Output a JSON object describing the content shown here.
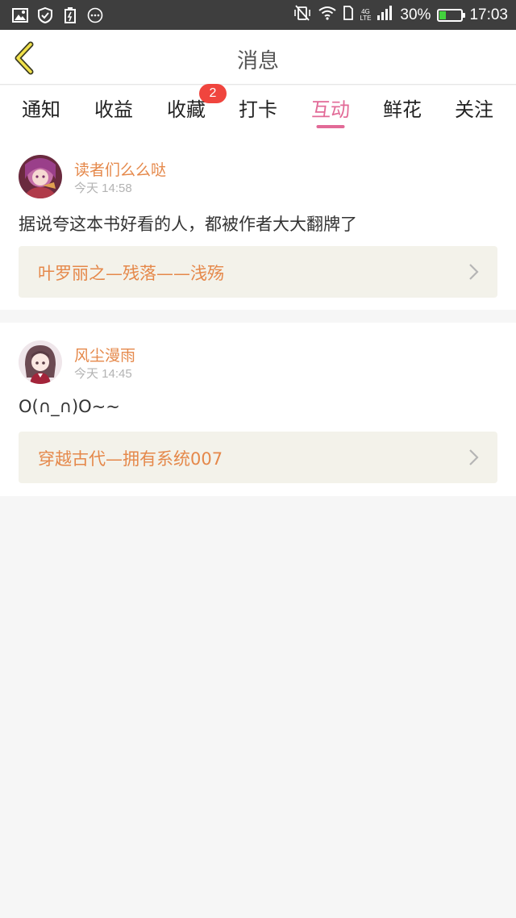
{
  "status_bar": {
    "left_icons": [
      "image-icon",
      "shield-icon",
      "battery-saver-icon",
      "more-dots-icon"
    ],
    "network": "4G",
    "network_sub": "LTE",
    "battery": "30%",
    "battery_level": 0.3,
    "time": "17:03"
  },
  "header": {
    "title": "消息"
  },
  "tabs": [
    {
      "label": "通知"
    },
    {
      "label": "收益"
    },
    {
      "label": "收藏",
      "badge": "2"
    },
    {
      "label": "打卡"
    },
    {
      "label": "互动",
      "active": true
    },
    {
      "label": "鲜花"
    },
    {
      "label": "关注"
    }
  ],
  "messages": [
    {
      "user": "读者们么么哒",
      "time": "今天 14:58",
      "text": "据说夸这本书好看的人，都被作者大大翻牌了",
      "book": "叶罗丽之—残落——浅殇"
    },
    {
      "user": "风尘漫雨",
      "time": "今天 14:45",
      "text": "O(∩_∩)O~~",
      "book": "穿越古代—拥有系统007"
    }
  ],
  "colors": {
    "accent": "#e26a97",
    "username": "#e5884a",
    "badge": "#f0453e",
    "status_bar": "#3e3e3e"
  }
}
